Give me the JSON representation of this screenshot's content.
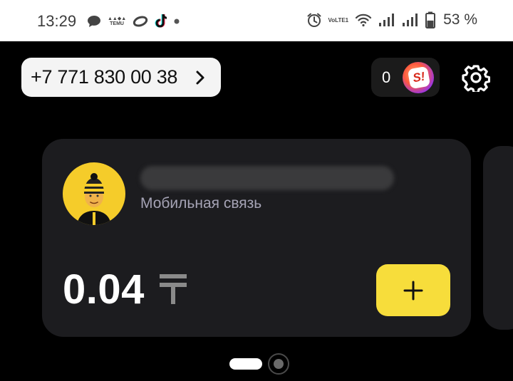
{
  "status_bar": {
    "time": "13:29",
    "temu_label": "TEMU",
    "volte_label": "VoLTE1",
    "battery_percent": "53 %",
    "battery_level": 0.53
  },
  "header": {
    "phone_number": "+7 771 830 00 38",
    "bonus_count": "0",
    "bonus_badge_label": "S!"
  },
  "card": {
    "account_name": "",
    "account_type": "Мобильная связь",
    "balance": "0.04",
    "currency_icon": "tenge-icon",
    "topup_icon": "plus-icon"
  },
  "pager": {
    "pages": 2,
    "active_index": 0
  },
  "colors": {
    "background": "#000000",
    "card": "#1c1c1f",
    "accent_yellow": "#f7dd3b",
    "secondary_text": "#a5a3b5"
  }
}
